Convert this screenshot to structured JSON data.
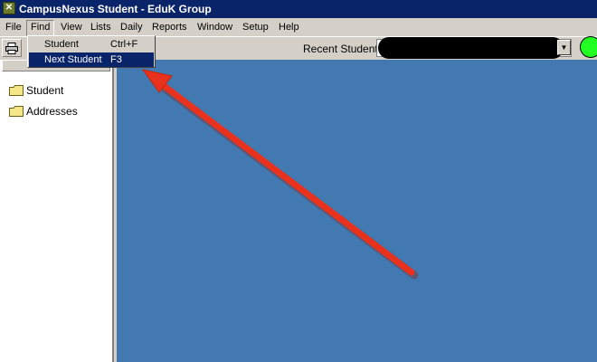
{
  "window": {
    "title": "CampusNexus Student - EduK Group",
    "app_icon": "campusnexus-app-icon"
  },
  "menubar": {
    "items": [
      {
        "label": "File"
      },
      {
        "label": "Find"
      },
      {
        "label": "View"
      },
      {
        "label": "Lists"
      },
      {
        "label": "Daily"
      },
      {
        "label": "Reports"
      },
      {
        "label": "Window"
      },
      {
        "label": "Setup"
      },
      {
        "label": "Help"
      }
    ],
    "open_menu": "Find"
  },
  "find_menu": {
    "items": [
      {
        "label": "Student",
        "shortcut": "Ctrl+F",
        "highlighted": false
      },
      {
        "label": "Next Student",
        "shortcut": "F3",
        "highlighted": true
      }
    ]
  },
  "toolbar": {
    "print_icon": "printer-icon",
    "recent_students_label": "Recent Students",
    "recent_students_value": ""
  },
  "status_indicator": {
    "color": "#22ff22"
  },
  "tree": {
    "items": [
      {
        "label": "Student",
        "icon": "folder-icon"
      },
      {
        "label": "Addresses",
        "icon": "folder-icon"
      }
    ]
  },
  "colors": {
    "titlebar": "#0a246a",
    "workspace": "#4279b0",
    "highlight": "#0a246a",
    "annotation_arrow": "#e8321e"
  }
}
